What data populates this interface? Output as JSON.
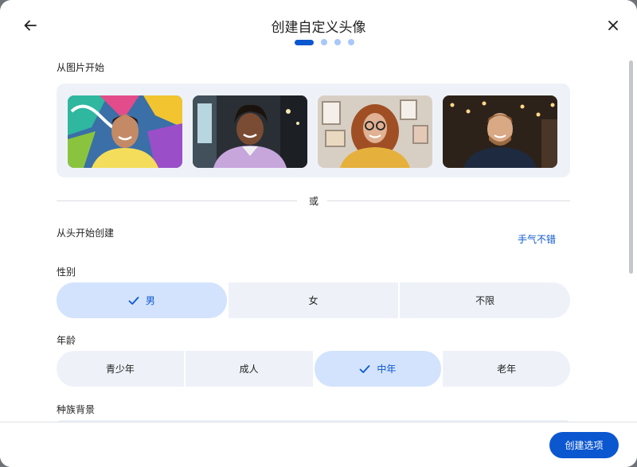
{
  "dialog": {
    "title": "创建自定义头像",
    "steps_total": 4,
    "step_current": 1
  },
  "photos": {
    "section_label": "从图片开始",
    "items": [
      {
        "name": "photo-graffiti-man"
      },
      {
        "name": "photo-storefront-woman"
      },
      {
        "name": "photo-gallery-woman"
      },
      {
        "name": "photo-cafe-man"
      }
    ]
  },
  "or_text": "或",
  "scratch": {
    "section_label": "从头开始创建",
    "lucky_label": "手气不错"
  },
  "gender": {
    "label": "性别",
    "options": [
      "男",
      "女",
      "不限"
    ],
    "selected": "男"
  },
  "age": {
    "label": "年龄",
    "options": [
      "青少年",
      "成人",
      "中年",
      "老年"
    ],
    "selected": "中年"
  },
  "ethnicity": {
    "label": "种族背景"
  },
  "footer": {
    "create_label": "创建选项"
  },
  "colors": {
    "accent": "#0b57d0",
    "selected_bg": "#d3e3fd",
    "panel_bg": "#eef2f8"
  },
  "icons": {
    "back": "arrow-left-icon",
    "close": "close-icon",
    "check": "check-icon"
  }
}
